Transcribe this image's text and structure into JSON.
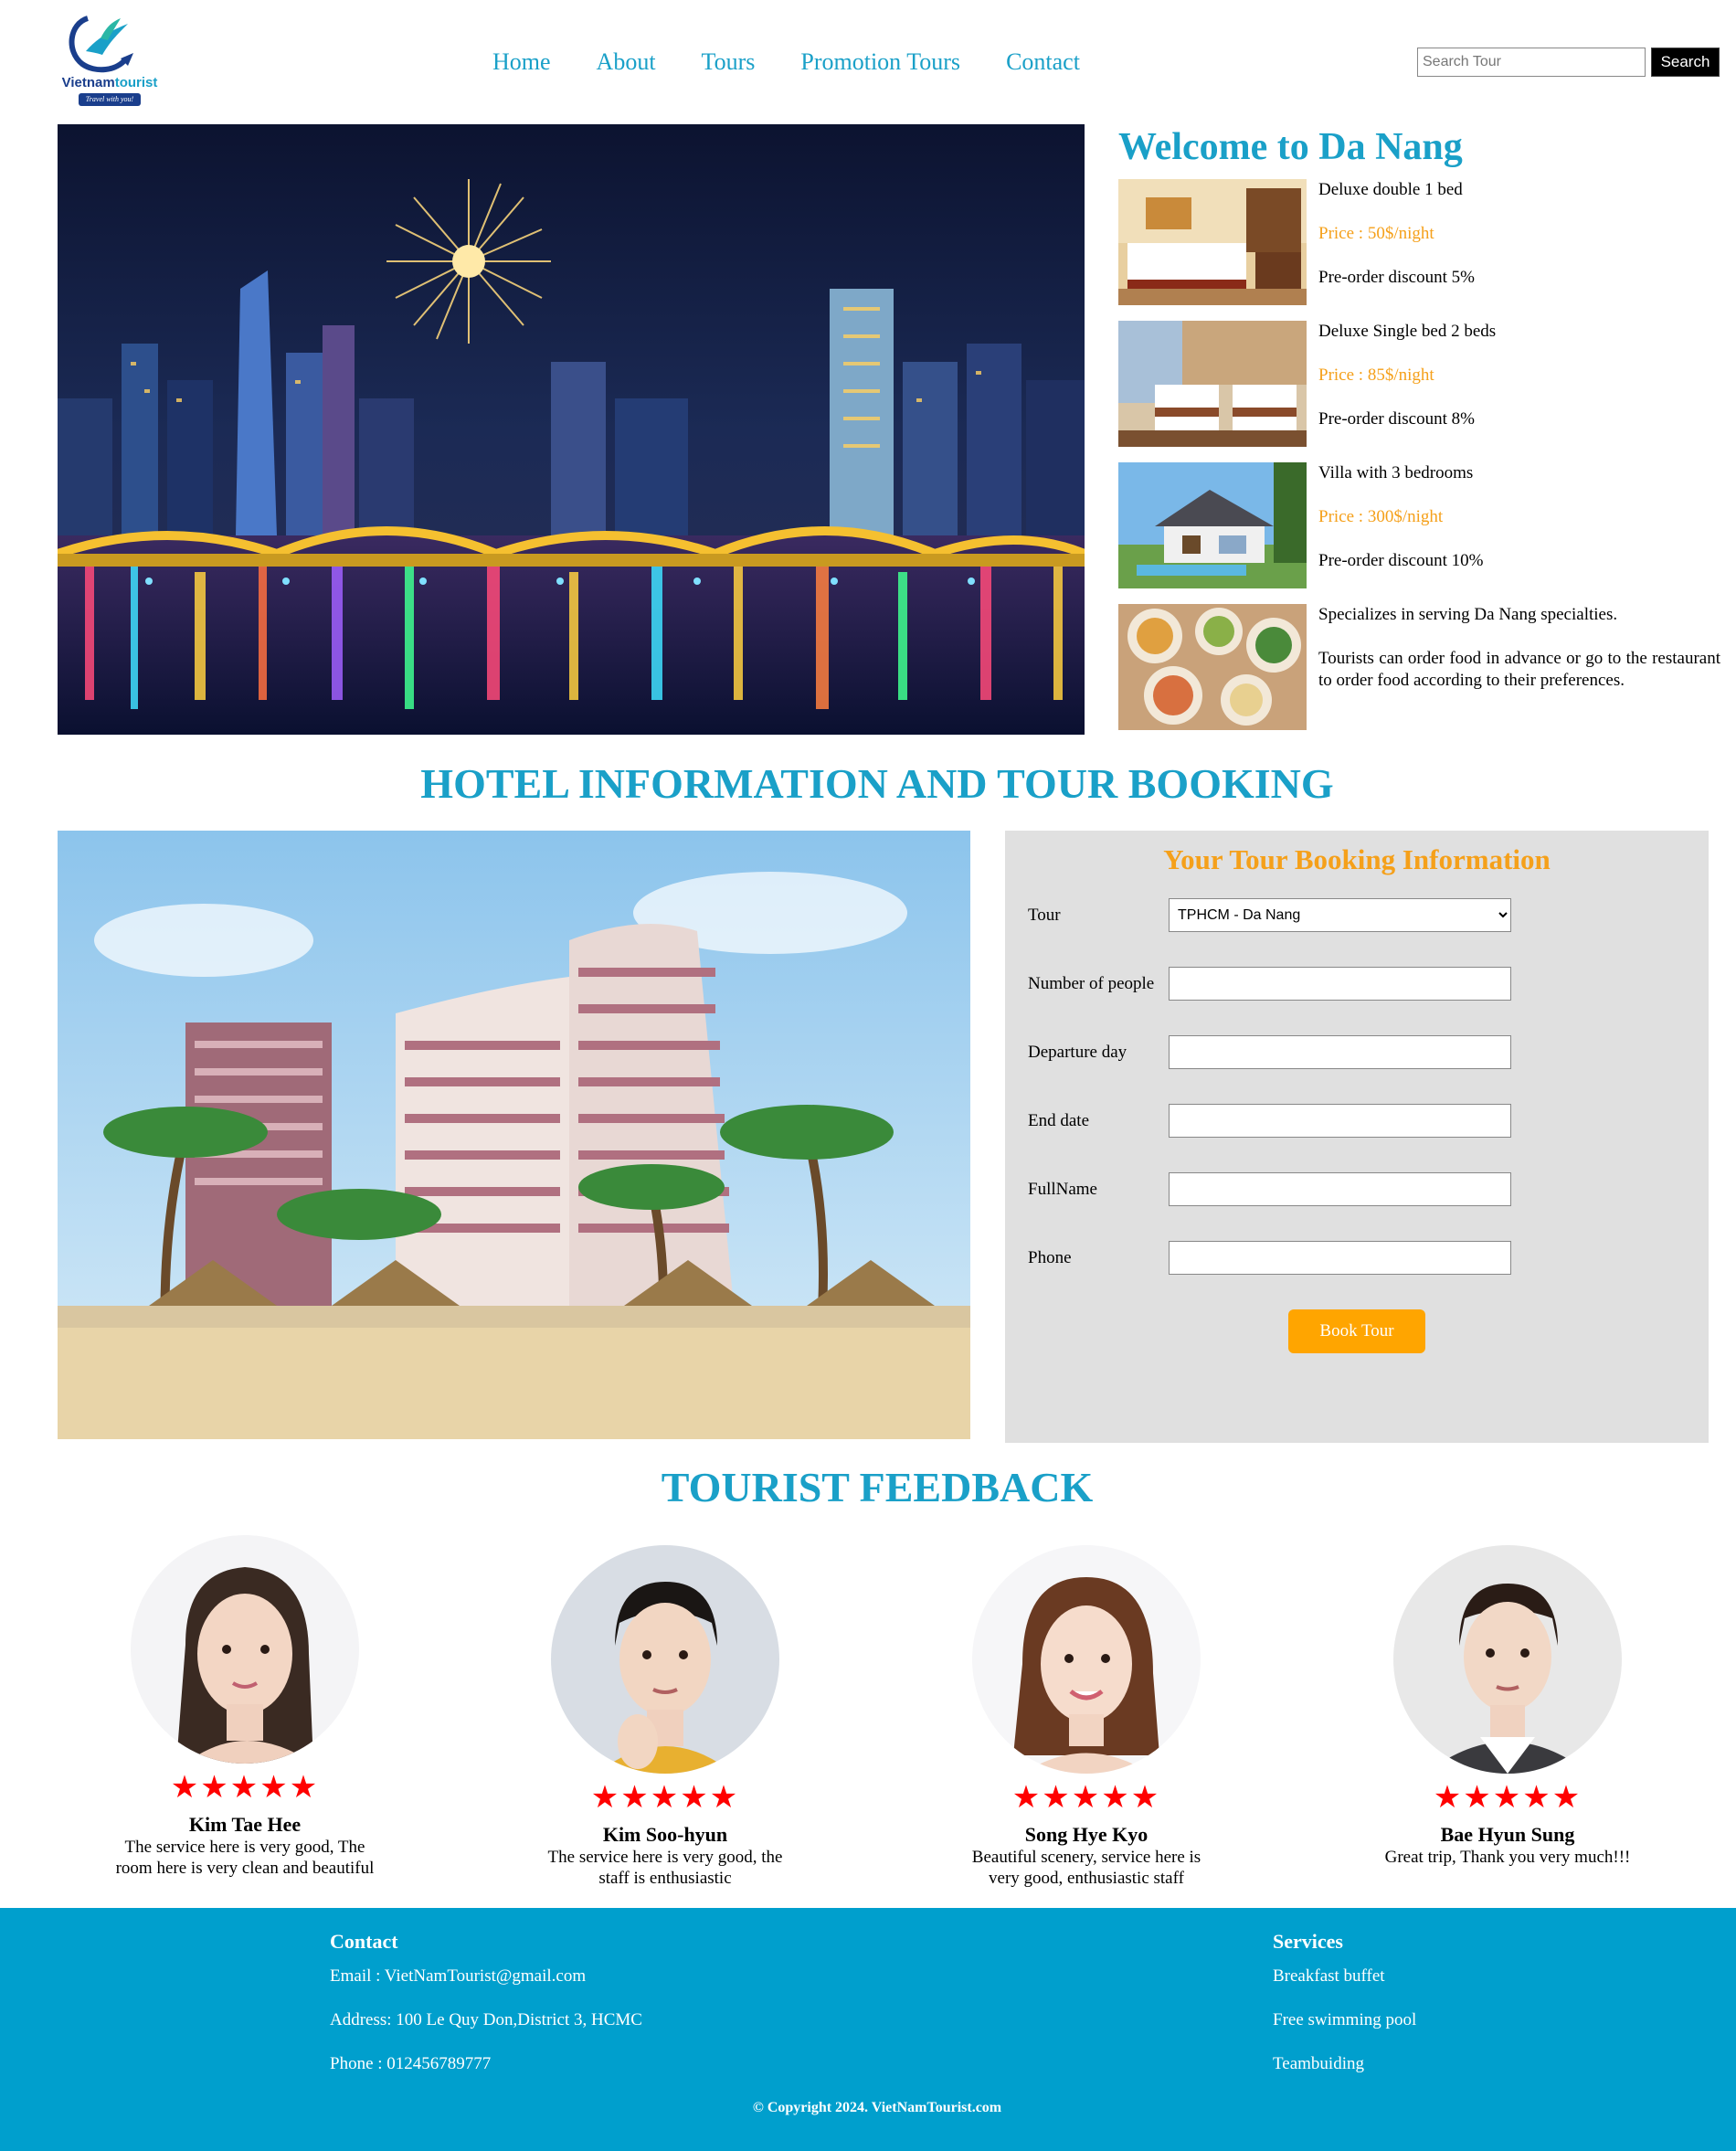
{
  "header": {
    "logo_brand": "Vietnam",
    "logo_brand_accent": "tourist",
    "logo_tagline": "Travel with you!",
    "nav": [
      {
        "label": "Home"
      },
      {
        "label": "About"
      },
      {
        "label": "Tours"
      },
      {
        "label": "Promotion Tours"
      },
      {
        "label": "Contact"
      }
    ],
    "search_placeholder": "Search Tour",
    "search_button": "Search"
  },
  "welcome": {
    "title": "Welcome to Da Nang",
    "rooms": [
      {
        "name": "Deluxe double 1 bed",
        "price": "Price : 50$/night",
        "discount": "Pre-order discount 5%"
      },
      {
        "name": "Deluxe Single bed 2 beds",
        "price": "Price : 85$/night",
        "discount": "Pre-order discount 8%"
      },
      {
        "name": "Villa with 3 bedrooms",
        "price": "Price : 300$/night",
        "discount": "Pre-order discount 10%"
      }
    ],
    "food": {
      "line1": "Specializes in serving Da Nang specialties.",
      "line2": "Tourists can order food in advance or go to the restaurant to order food according to their preferences."
    }
  },
  "booking_section_title": "HOTEL INFORMATION AND TOUR BOOKING",
  "booking": {
    "title": "Your Tour Booking Information",
    "tour_label": "Tour",
    "tour_selected": "TPHCM - Da Nang",
    "people_label": "Number of people",
    "departure_label": "Departure day",
    "end_label": "End date",
    "fullname_label": "FullName",
    "phone_label": "Phone",
    "button": "Book Tour"
  },
  "feedback_title": "TOURIST FEEDBACK",
  "feedback": [
    {
      "name": "Kim Tae Hee",
      "stars": "★★★★★",
      "comment": "The service here is very good, The room here is very clean and beautiful"
    },
    {
      "name": "Kim Soo-hyun",
      "stars": "★★★★★",
      "comment": "The service here is very good, the staff is enthusiastic"
    },
    {
      "name": "Song Hye Kyo",
      "stars": "★★★★★",
      "comment": "Beautiful scenery, service here is very good, enthusiastic staff"
    },
    {
      "name": "Bae Hyun Sung",
      "stars": "★★★★★",
      "comment": "Great trip, Thank you very much!!!"
    }
  ],
  "footer": {
    "contact_title": "Contact",
    "email": "Email : VietNamTourist@gmail.com",
    "address": "Address: 100 Le Quy Don,District 3, HCMC",
    "phone": "Phone : 012456789777",
    "services_title": "Services",
    "services": [
      "Breakfast buffet",
      "Free swimming pool",
      "Teambuiding"
    ],
    "copyright": "© Copyright 2024. VietNamTourist.com"
  },
  "colors": {
    "accent": "#1aa0c8",
    "price": "#f5a01a",
    "button": "#ffa500",
    "footer": "#009fcd",
    "stars": "#ff0000"
  }
}
